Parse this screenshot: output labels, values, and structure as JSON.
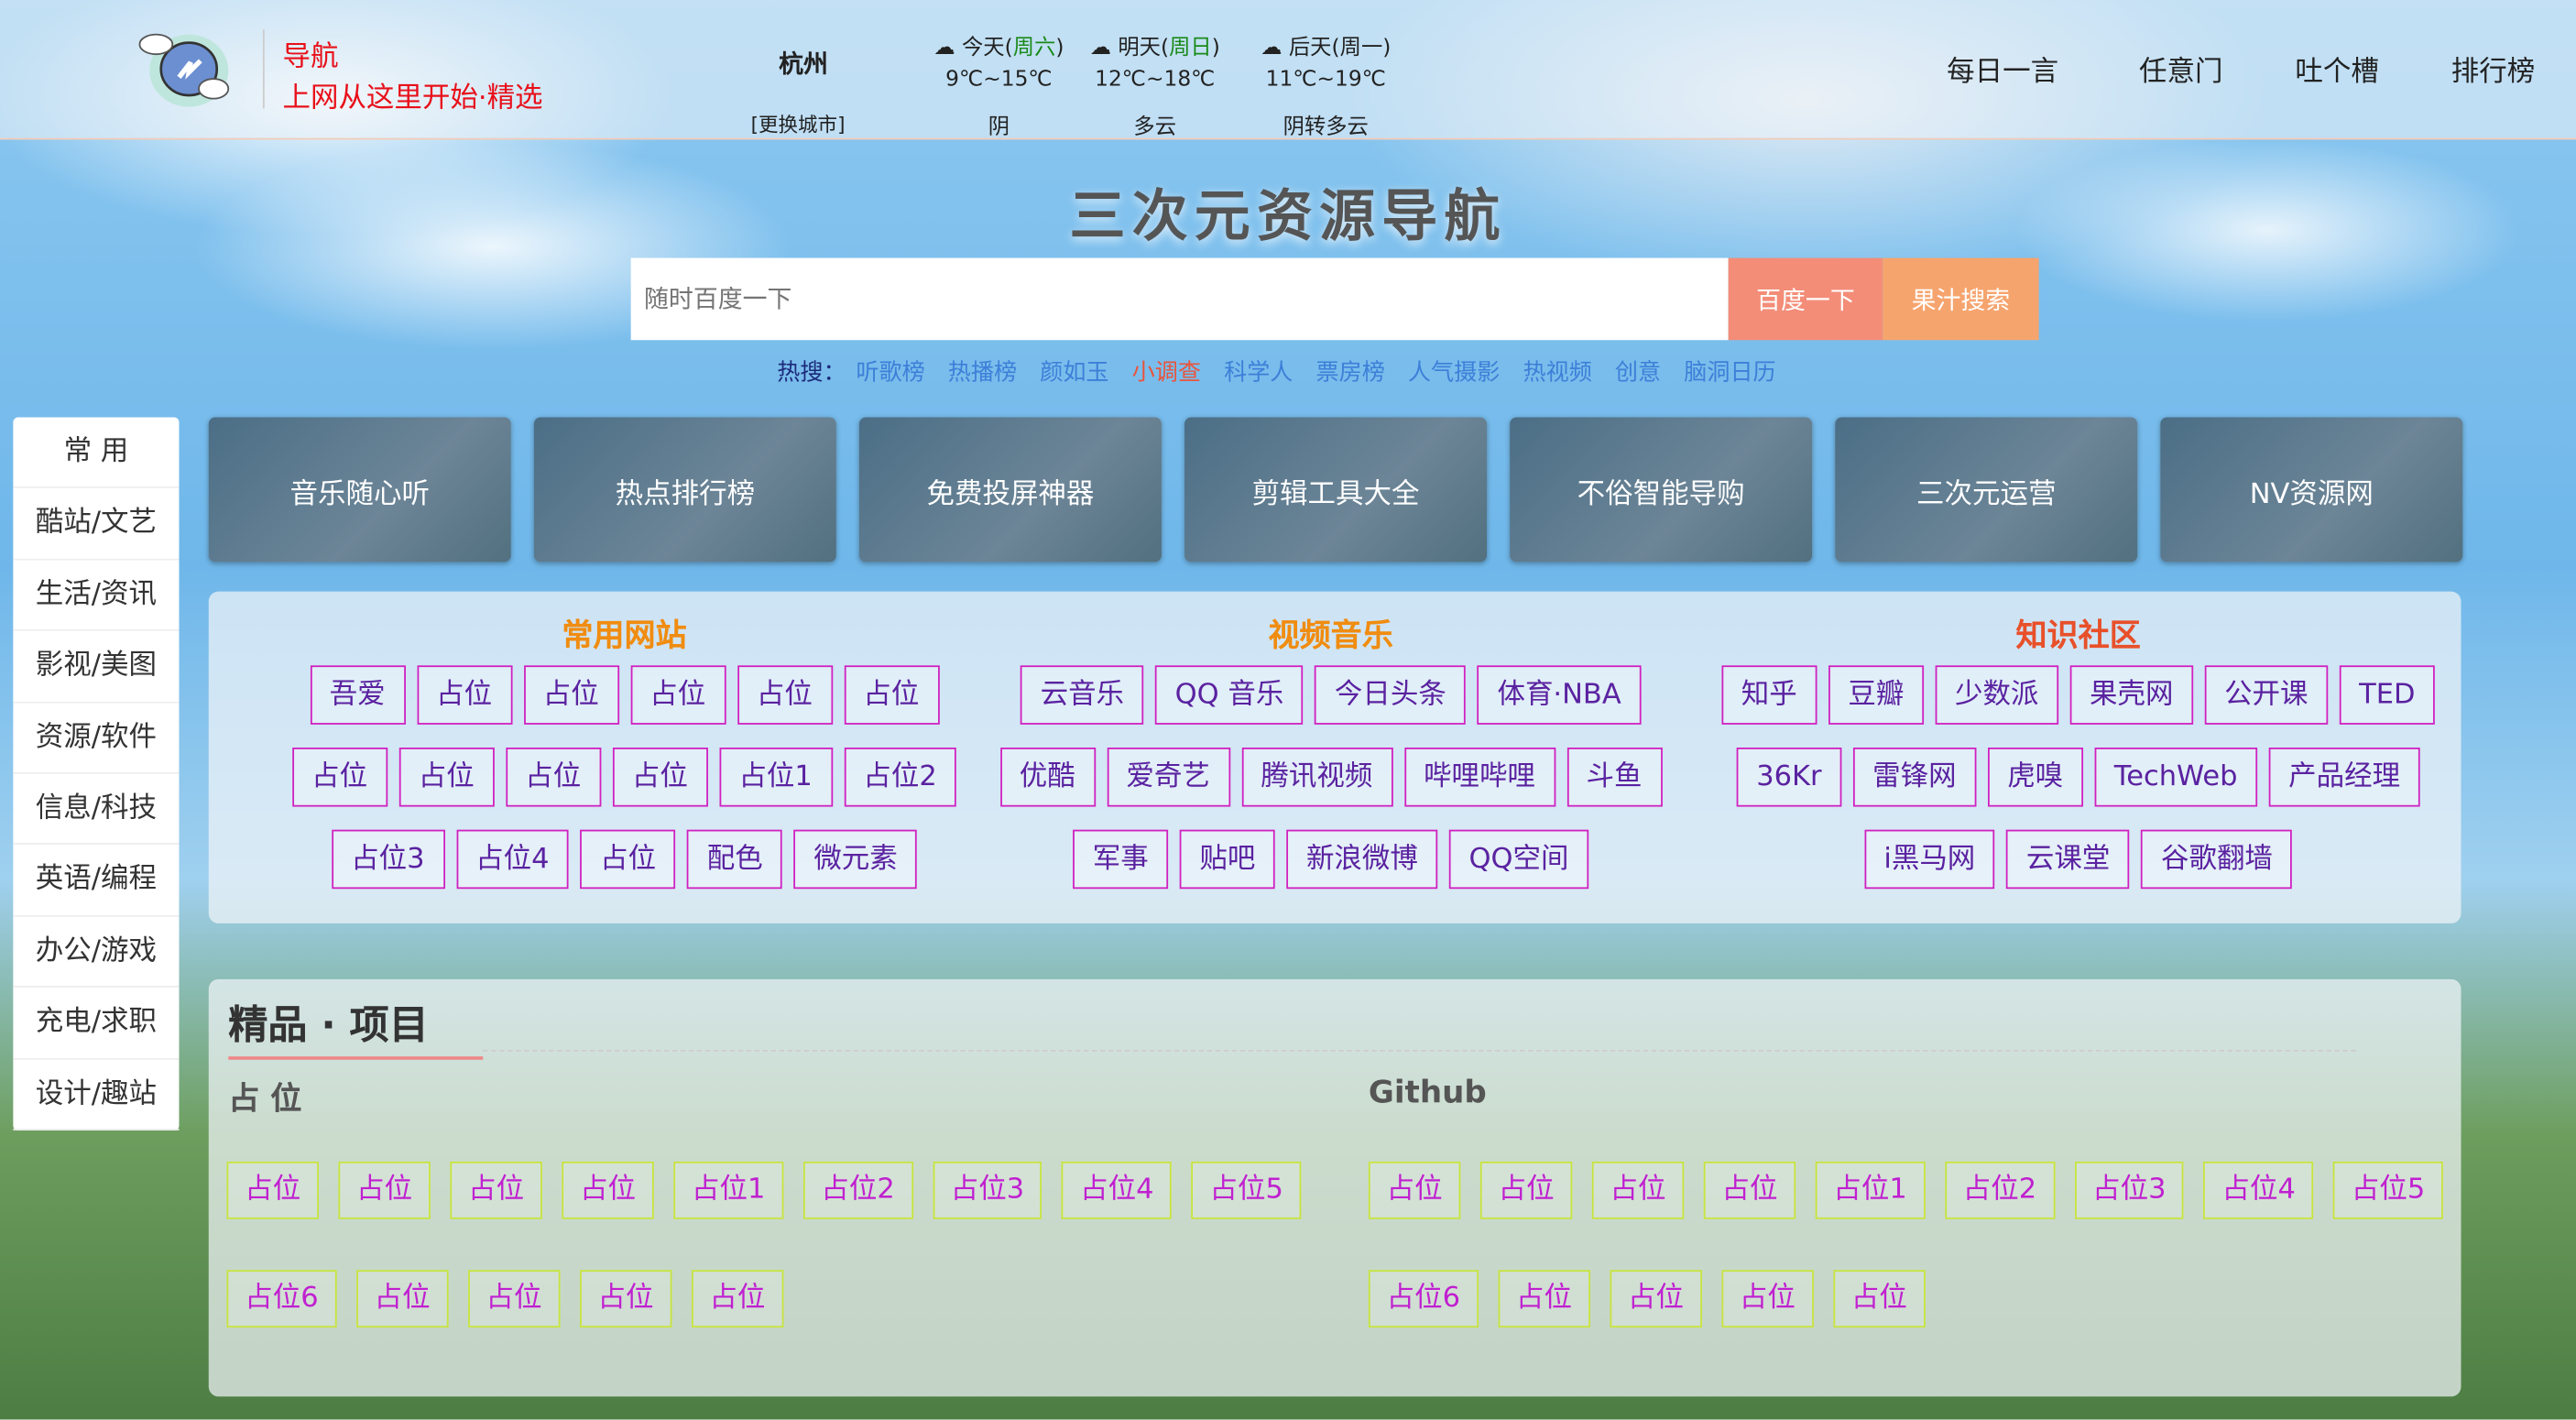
{
  "header": {
    "brand_title": "导航",
    "brand_slogan": "上网从这里开始·精选",
    "city": "杭州",
    "change_city": "[更换城市]",
    "weather": [
      {
        "day": "今天",
        "weekday": "周六",
        "temp": "9℃~15℃",
        "cond": "阴"
      },
      {
        "day": "明天",
        "weekday": "周日",
        "temp": "12℃~18℃",
        "cond": "多云"
      },
      {
        "day": "后天",
        "weekday": "周一",
        "temp": "11℃~19℃",
        "cond": "阴转多云"
      }
    ],
    "nav": [
      "每日一言",
      "任意门",
      "吐个槽",
      "排行榜"
    ]
  },
  "site_title": "三次元资源导航",
  "search": {
    "placeholder": "随时百度一下",
    "baidu_button": "百度一下",
    "juice_button": "果汁搜索"
  },
  "hot": {
    "label": "热搜：",
    "items": [
      "听歌榜",
      "热播榜",
      "颜如玉",
      "小调查",
      "科学人",
      "票房榜",
      "人气摄影",
      "热视频",
      "创意",
      "脑洞日历"
    ],
    "highlight": "小调查"
  },
  "sidebar": [
    "常 用",
    "酷站/文艺",
    "生活/资讯",
    "影视/美图",
    "资源/软件",
    "信息/科技",
    "英语/编程",
    "办公/游戏",
    "充电/求职",
    "设计/趣站"
  ],
  "tiles": [
    "音乐随心听",
    "热点排行榜",
    "免费投屏神器",
    "剪辑工具大全",
    "不俗智能导购",
    "三次元运营",
    "NV资源网"
  ],
  "columns": [
    {
      "title": "常用网站",
      "color": "#f08c10",
      "rows": [
        [
          "吾爱",
          "占位",
          "占位",
          "占位",
          "占位",
          "占位"
        ],
        [
          "占位",
          "占位",
          "占位",
          "占位",
          "占位1",
          "占位2"
        ],
        [
          "占位3",
          "占位4",
          "占位",
          "配色",
          "微元素"
        ]
      ]
    },
    {
      "title": "视频音乐",
      "color": "#f08c10",
      "rows": [
        [
          "云音乐",
          "QQ 音乐",
          "今日头条",
          "体育·NBA"
        ],
        [
          "优酷",
          "爱奇艺",
          "腾讯视频",
          "哔哩哔哩",
          "斗鱼"
        ],
        [
          "军事",
          "贴吧",
          "新浪微博",
          "QQ空间"
        ]
      ]
    },
    {
      "title": "知识社区",
      "color": "#e8502a",
      "rows": [
        [
          "知乎",
          "豆瓣",
          "少数派",
          "果壳网",
          "公开课",
          "TED"
        ],
        [
          "36Kr",
          "雷锋网",
          "虎嗅",
          "TechWeb",
          "产品经理"
        ],
        [
          "i黑马网",
          "云课堂",
          "谷歌翻墙"
        ]
      ]
    }
  ],
  "featured": {
    "title": "精品 · 项目",
    "left_title": "占 位",
    "right_title": "Github",
    "left": [
      "占位",
      "占位",
      "占位",
      "占位",
      "占位1",
      "占位2",
      "占位3",
      "占位4",
      "占位5",
      "占位6",
      "占位",
      "占位",
      "占位",
      "占位"
    ],
    "right": [
      "占位",
      "占位",
      "占位",
      "占位",
      "占位1",
      "占位2",
      "占位3",
      "占位4",
      "占位5",
      "占位6",
      "占位",
      "占位",
      "占位",
      "占位"
    ]
  }
}
